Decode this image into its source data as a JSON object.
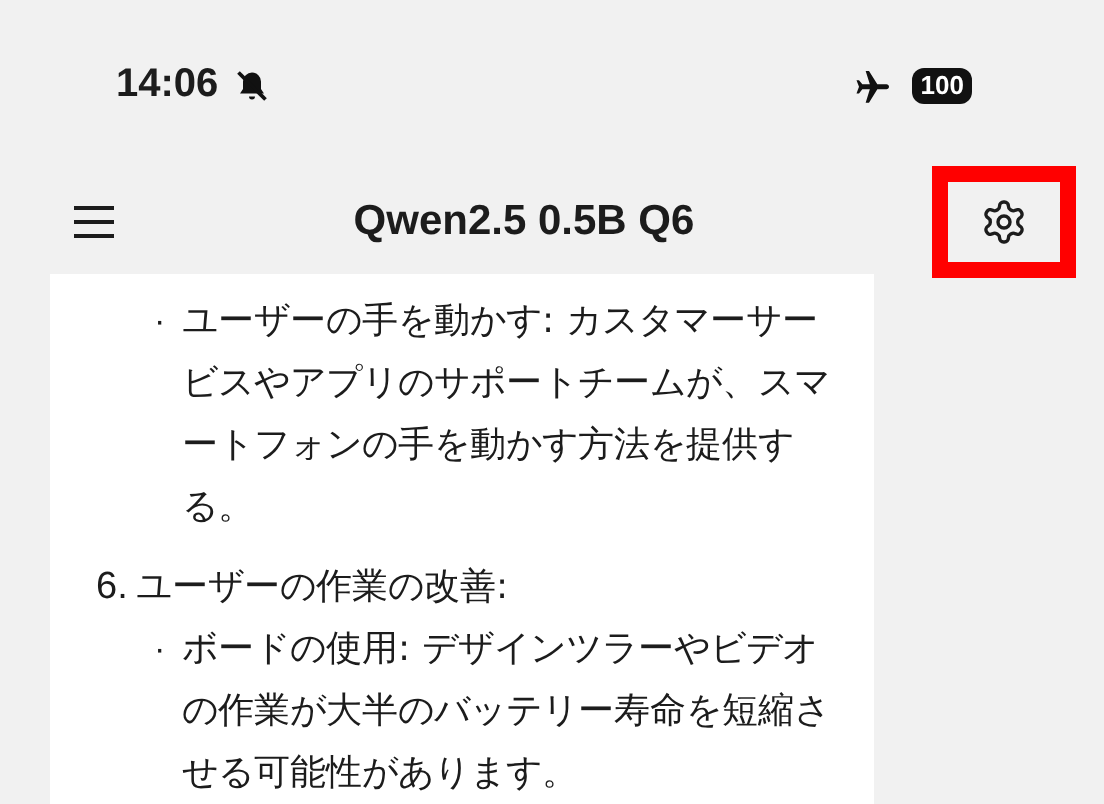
{
  "status_bar": {
    "time": "14:06",
    "battery": "100"
  },
  "header": {
    "title": "Qwen2.5 0.5B Q6",
    "settings_highlighted": true
  },
  "message": {
    "blocks": [
      {
        "kind": "bullet",
        "marker": "·",
        "text": "ユーザーの手を動かす: カスタマーサービスやアプリのサポートチームが、スマートフォンの手を動かす方法を提供する。"
      },
      {
        "kind": "numbered",
        "marker": "6.",
        "text": "ユーザーの作業の改善:"
      },
      {
        "kind": "bullet",
        "marker": "·",
        "text": "ボードの使用: デザインツラーやビデオの作業が大半のバッテリー寿命を短縮させる可能性があります。"
      }
    ]
  }
}
